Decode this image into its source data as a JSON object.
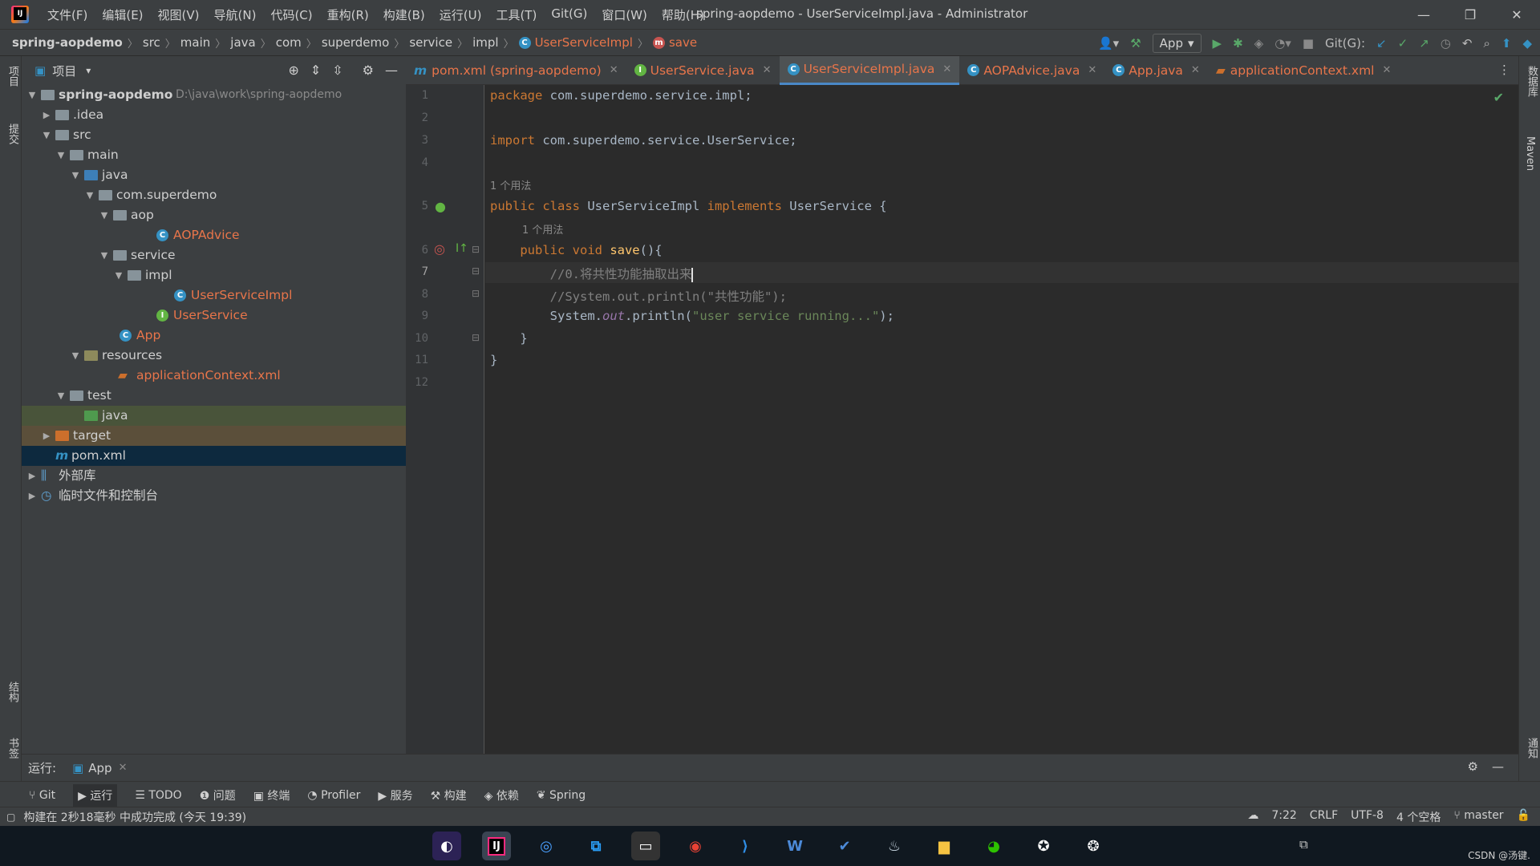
{
  "window": {
    "title": "spring-aopdemo - UserServiceImpl.java - Administrator",
    "menu": [
      "文件(F)",
      "编辑(E)",
      "视图(V)",
      "导航(N)",
      "代码(C)",
      "重构(R)",
      "构建(B)",
      "运行(U)",
      "工具(T)",
      "Git(G)",
      "窗口(W)",
      "帮助(H)"
    ],
    "controls": {
      "minimize": "—",
      "restore": "❐",
      "close": "✕"
    }
  },
  "breadcrumb": [
    "spring-aopdemo",
    "src",
    "main",
    "java",
    "com",
    "superdemo",
    "service",
    "impl",
    "UserServiceImpl",
    "save"
  ],
  "toolbar": {
    "run_config": "App",
    "git_label": "Git(G):"
  },
  "project_panel": {
    "title": "项目",
    "tree": [
      {
        "label": "spring-aopdemo",
        "path": "D:\\java\\work\\spring-aopdemo"
      },
      {
        "label": ".idea"
      },
      {
        "label": "src"
      },
      {
        "label": "main"
      },
      {
        "label": "java"
      },
      {
        "label": "com.superdemo"
      },
      {
        "label": "aop"
      },
      {
        "label": "AOPAdvice"
      },
      {
        "label": "service"
      },
      {
        "label": "impl"
      },
      {
        "label": "UserServiceImpl"
      },
      {
        "label": "UserService"
      },
      {
        "label": "App"
      },
      {
        "label": "resources"
      },
      {
        "label": "applicationContext.xml"
      },
      {
        "label": "test"
      },
      {
        "label": "java"
      },
      {
        "label": "target"
      },
      {
        "label": "pom.xml"
      },
      {
        "label": "外部库"
      },
      {
        "label": "临时文件和控制台"
      }
    ]
  },
  "side_labels": {
    "left": [
      "项目",
      "提交",
      "结构",
      "书签"
    ],
    "right": [
      "数据库",
      "Maven",
      "通知"
    ]
  },
  "tabs": [
    {
      "label": "pom.xml (spring-aopdemo)"
    },
    {
      "label": "UserService.java"
    },
    {
      "label": "UserServiceImpl.java"
    },
    {
      "label": "AOPAdvice.java"
    },
    {
      "label": "App.java"
    },
    {
      "label": "applicationContext.xml"
    }
  ],
  "editor": {
    "line_numbers": [
      "1",
      "2",
      "3",
      "4",
      "5",
      "6",
      "7",
      "8",
      "9",
      "10",
      "11",
      "12"
    ],
    "usage_hint": "1 个用法",
    "lines": {
      "l1_kw": "package",
      "l1_rest": " com.superdemo.service.impl;",
      "l3_kw": "import",
      "l3_rest": " com.superdemo.service.UserService;",
      "l5_kw1": "public class",
      "l5_name": " UserServiceImpl ",
      "l5_kw2": "implements",
      "l5_rest": " UserService {",
      "l6_kw": "    public void ",
      "l6_fn": "save",
      "l6_rest": "(){",
      "l7": "        //0.将共性功能抽取出来",
      "l8": "        //System.out.println(\"共性功能\");",
      "l9_a": "        System.",
      "l9_out": "out",
      "l9_b": ".println(",
      "l9_str": "\"user service running...\"",
      "l9_c": ");",
      "l10": "    }",
      "l11": "}"
    }
  },
  "run_bar": {
    "label": "运行:",
    "tab": "App"
  },
  "tool_windows": [
    "Git",
    "运行",
    "TODO",
    "问题",
    "终端",
    "Profiler",
    "服务",
    "构建",
    "依赖",
    "Spring"
  ],
  "status": {
    "message": "构建在 2秒18毫秒 中成功完成 (今天 19:39)",
    "position": "7:22",
    "line_sep": "CRLF",
    "encoding": "UTF-8",
    "indent": "4 个空格",
    "branch": "master"
  },
  "taskbar": {
    "watermark": "CSDN @汤键."
  },
  "colors": {
    "accent": "#4a88c7",
    "keyword": "#cc7832",
    "string": "#6a8759",
    "orange_file": "#e8754a"
  }
}
